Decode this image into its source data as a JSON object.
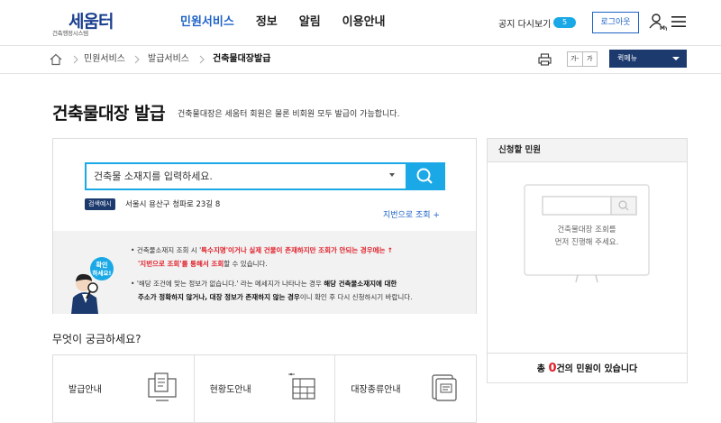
{
  "header": {
    "logo_text": "세움터",
    "logo_sub": "건축행정시스템",
    "nav": [
      {
        "label": "민원서비스",
        "active": true
      },
      {
        "label": "정보",
        "active": false
      },
      {
        "label": "알림",
        "active": false
      },
      {
        "label": "이용안내",
        "active": false
      }
    ],
    "notice_label": "공지 다시보기",
    "notice_count": "5",
    "logout_label": "로그아웃",
    "my_label": "My"
  },
  "breadcrumb": {
    "items": [
      "민원서비스",
      "발급서비스",
      "건축물대장발급"
    ],
    "font_small": "가-",
    "font_large": "가",
    "quick_menu": "퀵메뉴"
  },
  "page": {
    "title": "건축물대장 발급",
    "subtitle": "건축물대장은 세움터 회원은 물론 비회원 모두 발급이 가능합니다."
  },
  "search": {
    "placeholder": "건축물 소재지를 입력하세요.",
    "example_tag": "검색예시",
    "example_text": "서울시 용산구 청파로 23길 8",
    "lot_link": "지번으로 조회 +"
  },
  "guide": {
    "badge_line1": "확인",
    "badge_line2": "하세요!",
    "b1_pre": "건축물소재지 조회 시 '",
    "b1_red1": "특수지명'이거나 실제 건물이 존재하지만 조회가 안되는 경우에는",
    "b1_arrow": "↑",
    "b1b_red": "'지번으로 조회'를 통해서 조회",
    "b1b_post": "할 수 있습니다.",
    "b2_pre": "'해당 조건에 맞는 정보가 없습니다.' 라는 메세지가 나타나는 경우",
    "b2_bold1": "해당 건축물소재지에 대한",
    "b2b_bold": "주소가 정확하지 않거나, 대장 정보가 존재하지 않는 경우",
    "b2b_post": "이니 확인 후 다시 신청하시기 바랍니다."
  },
  "faq": {
    "title": "무엇이 궁금하세요?",
    "cards": [
      {
        "label": "발급안내",
        "icon": "document-monitor-icon"
      },
      {
        "label": "현황도안내",
        "icon": "floor-plan-icon"
      },
      {
        "label": "대장종류안내",
        "icon": "document-stack-icon"
      }
    ]
  },
  "apply_panel": {
    "title": "신청할 민원",
    "empty_line1": "건축물대장 조회를",
    "empty_line2": "먼저 진행해 주세요.",
    "count_pre": "총 ",
    "count": "0",
    "count_post": "건의 민원이 있습니다"
  },
  "colors": {
    "accent": "#1aa9e6",
    "nav_active": "#1e63c8",
    "dark_navy": "#1c3a6e",
    "alert_red": "#e0202a"
  }
}
